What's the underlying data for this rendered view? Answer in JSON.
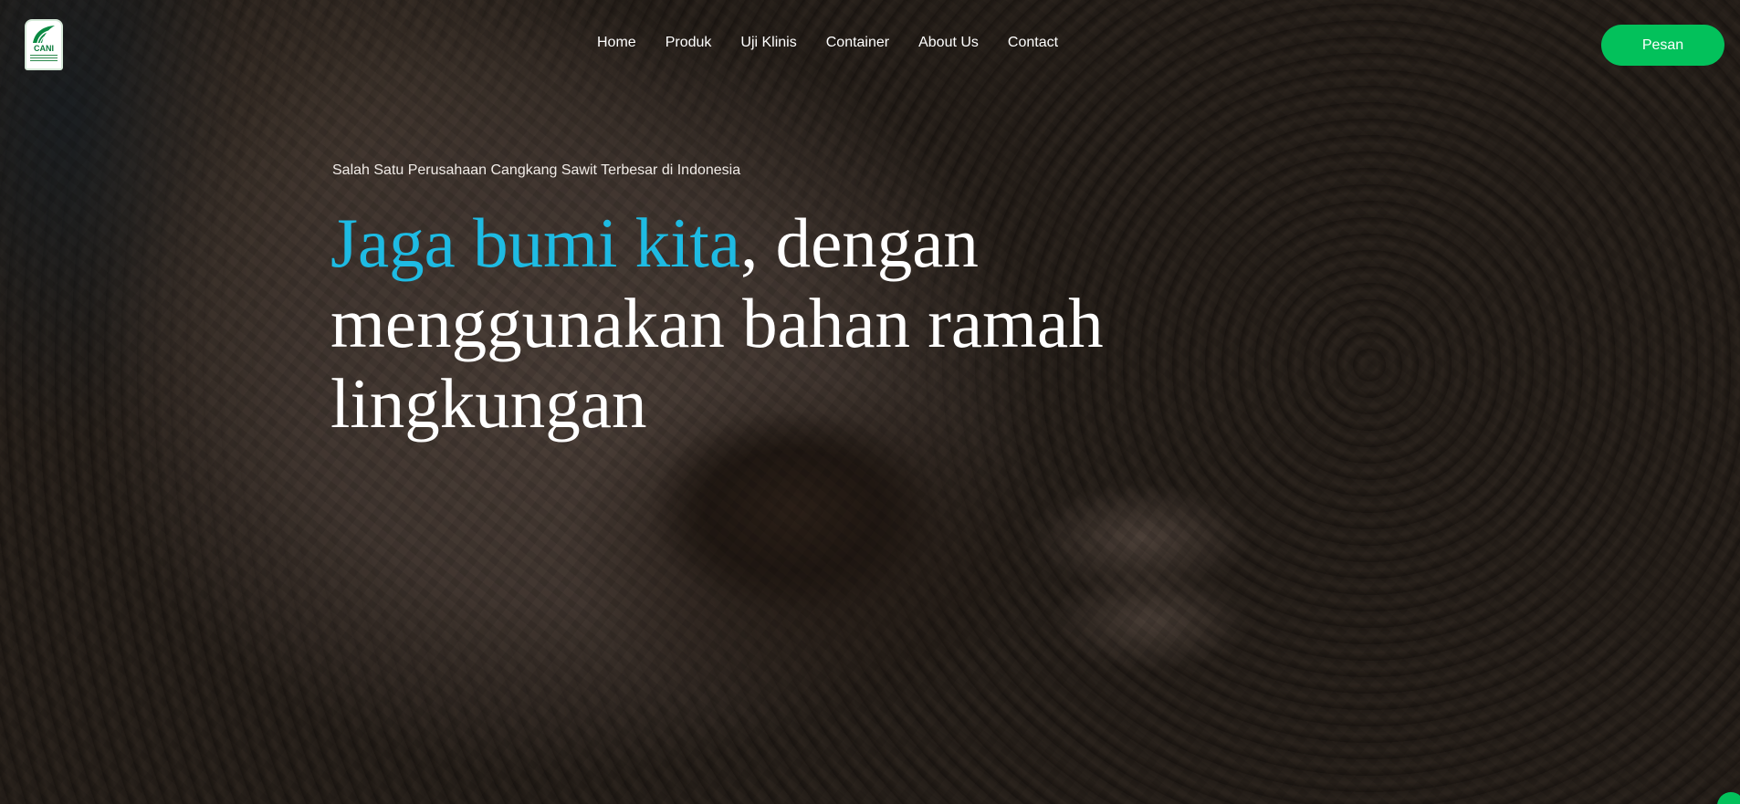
{
  "header": {
    "logo_text": "CANI",
    "nav_items": [
      {
        "label": "Home"
      },
      {
        "label": "Produk"
      },
      {
        "label": "Uji Klinis"
      },
      {
        "label": "Container"
      },
      {
        "label": "About Us"
      },
      {
        "label": "Contact"
      }
    ],
    "cta_label": "Pesan"
  },
  "hero": {
    "eyebrow": "Salah Satu Perusahaan Cangkang Sawit Terbesar di Indonesia",
    "headline_accent": "Jaga bumi kita",
    "headline_rest": ", dengan menggunakan bahan ramah lingkungan"
  },
  "colors": {
    "accent": "#1ebbe3",
    "cta": "#03c15b"
  },
  "icons": {
    "logo": "leaf-logo-icon",
    "chat": "chat-bubble-icon"
  }
}
